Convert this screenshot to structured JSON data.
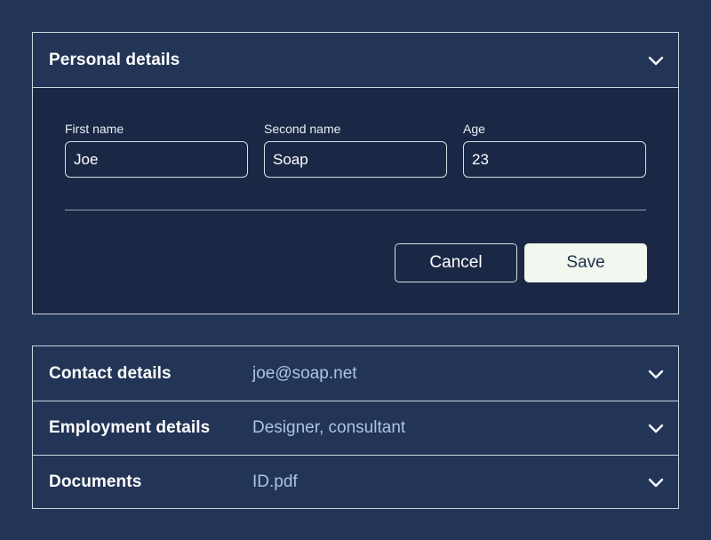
{
  "personal": {
    "title": "Personal details",
    "fields": [
      {
        "label": "First name",
        "value": "Joe"
      },
      {
        "label": "Second name",
        "value": "Soap"
      },
      {
        "label": "Age",
        "value": "23"
      }
    ],
    "cancel_label": "Cancel",
    "save_label": "Save",
    "expanded": true
  },
  "sections": [
    {
      "title": "Contact details",
      "value": "joe@soap.net"
    },
    {
      "title": "Employment details",
      "value": "Designer, consultant"
    },
    {
      "title": "Documents",
      "value": "ID.pdf"
    }
  ],
  "icons": {
    "expand": "chevron-down-icon"
  },
  "colors": {
    "background": "#233557",
    "panel_body": "#1b2845",
    "border": "#c9d3df",
    "value_text": "#a9c6e0",
    "save_button": "#f2f8ef"
  }
}
